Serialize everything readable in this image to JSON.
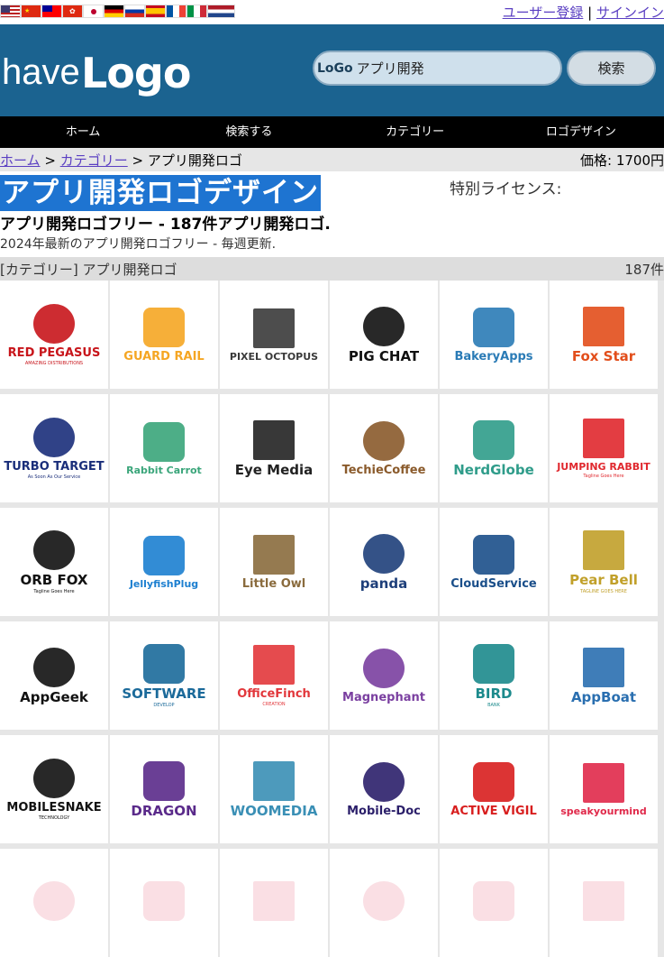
{
  "topbar": {
    "flags": [
      "us-flag",
      "cn-flag",
      "tw-flag",
      "hk-flag",
      "jp-flag",
      "de-flag",
      "ru-flag",
      "es-flag",
      "fr-flag",
      "it-flag",
      "nl-flag"
    ],
    "register": "ユーザー登録",
    "separator": "|",
    "signin": "サインイン"
  },
  "header": {
    "logo_have": "have",
    "logo_logo": "Logo",
    "search_logo": "LoGo",
    "search_value": "アプリ開発",
    "search_button": "検索"
  },
  "nav": [
    "ホーム",
    "検索する",
    "カテゴリー",
    "ロゴデザイン"
  ],
  "breadcrumb": {
    "home": "ホーム",
    "sep1": ">",
    "category": "カテゴリー",
    "sep2": ">",
    "current": "アプリ開発ロゴ",
    "price": "価格: 1700円"
  },
  "title": "アプリ開発ロゴデザイン",
  "license": "特別ライセンス:",
  "subtitle": "アプリ開発ロゴフリー - 187件アプリ開発ロゴ.",
  "description": "2024年最新のアプリ開発ロゴフリー - 毎週更新.",
  "category_bar": {
    "label": "[カテゴリー] アプリ開発ロゴ",
    "count": "187件"
  },
  "colors": {
    "header_bg": "#1b6390",
    "nav_bg": "#000000",
    "title_bg": "#1e74d1",
    "link": "#5a3fc2"
  },
  "logos": [
    {
      "name": "RED PEGASUS",
      "tag": "AMAZING DISTRIBUTIONS",
      "color": "#c8151b",
      "icon": "pegasus-icon"
    },
    {
      "name": "GUARD RAIL",
      "tag": "",
      "color": "#f5a623",
      "icon": "rail-icon"
    },
    {
      "name": "PIXEL OCTOPUS",
      "tag": "",
      "color": "#3a3a3a",
      "icon": "octopus-icon"
    },
    {
      "name": "PIG CHAT",
      "tag": "",
      "color": "#111111",
      "icon": "chat-bubble-icon"
    },
    {
      "name": "BakeryApps",
      "tag": "",
      "color": "#2a7bb6",
      "icon": "rolling-pin-icon"
    },
    {
      "name": "Fox Star",
      "tag": "",
      "color": "#e24e1b",
      "icon": "fox-icon"
    },
    {
      "name": "TURBO TARGET",
      "tag": "As Soon As Our Service",
      "color": "#1a2e7a",
      "icon": "target-icon"
    },
    {
      "name": "Rabbit Carrot",
      "tag": "",
      "color": "#3aa57a",
      "icon": "carrot-icon"
    },
    {
      "name": "Eye Media",
      "tag": "",
      "color": "#222222",
      "icon": "eye-icon"
    },
    {
      "name": "TechieCoffee",
      "tag": "",
      "color": "#8a5a2b",
      "icon": "coffee-bean-icon"
    },
    {
      "name": "NerdGlobe",
      "tag": "",
      "color": "#2f9c8a",
      "icon": "glasses-icon"
    },
    {
      "name": "JUMPING RABBIT",
      "tag": "Tagline Goes Here",
      "color": "#e0282e",
      "icon": "rabbit-icon"
    },
    {
      "name": "ORB FOX",
      "tag": "Tagline Goes Here",
      "color": "#111111",
      "icon": "fox-orb-icon"
    },
    {
      "name": "JellyfishPlug",
      "tag": "",
      "color": "#1c7fd0",
      "icon": "jellyfish-icon"
    },
    {
      "name": "Little Owl",
      "tag": "",
      "color": "#8a6b3d",
      "icon": "owl-icon"
    },
    {
      "name": "panda",
      "tag": "",
      "color": "#1e3f7a",
      "icon": "panda-icon"
    },
    {
      "name": "CloudService",
      "tag": "",
      "color": "#1b4f8a",
      "icon": "cloud-knot-icon"
    },
    {
      "name": "Pear Bell",
      "tag": "TAGLINE GOES HERE",
      "color": "#c1a02a",
      "icon": "pear-icon"
    },
    {
      "name": "AppGeek",
      "tag": "",
      "color": "#111111",
      "icon": "geek-icon"
    },
    {
      "name": "SOFTWARE",
      "tag": "DEVELOP",
      "color": "#1b6a9a",
      "icon": "pinwheel-icon"
    },
    {
      "name": "OfficeFinch",
      "tag": "CREATION",
      "color": "#e2373b",
      "icon": "finch-icon"
    },
    {
      "name": "Magnephant",
      "tag": "",
      "color": "#7a3fa0",
      "icon": "magnet-icon"
    },
    {
      "name": "BIRD",
      "tag": "BANK",
      "color": "#1c8a8c",
      "icon": "bird-icon"
    },
    {
      "name": "AppBoat",
      "tag": "",
      "color": "#2a6fb0",
      "icon": "boat-icon"
    },
    {
      "name": "MOBILESNAKE",
      "tag": "TECHNOLOGY",
      "color": "#111111",
      "icon": "snake-icon"
    },
    {
      "name": "DRAGON",
      "tag": "",
      "color": "#5a2a8a",
      "icon": "dragon-icon"
    },
    {
      "name": "WOOMEDIA",
      "tag": "",
      "color": "#3a8fb5",
      "icon": "wolf-icon"
    },
    {
      "name": "Mobile-Doc",
      "tag": "",
      "color": "#2b1f6a",
      "icon": "stethoscope-icon"
    },
    {
      "name": "ACTIVE VIGIL",
      "tag": "",
      "color": "#d81e1e",
      "icon": "heart-eye-icon"
    },
    {
      "name": "speakyourmind",
      "tag": "",
      "color": "#e0294a",
      "icon": "brain-icon"
    },
    {
      "name": "",
      "tag": "",
      "color": "#e0294a",
      "icon": "placeholder-icon"
    },
    {
      "name": "",
      "tag": "",
      "color": "#e0294a",
      "icon": "placeholder-icon"
    },
    {
      "name": "",
      "tag": "",
      "color": "#e0294a",
      "icon": "placeholder-icon"
    },
    {
      "name": "",
      "tag": "",
      "color": "#e0294a",
      "icon": "placeholder-icon"
    },
    {
      "name": "",
      "tag": "",
      "color": "#e0294a",
      "icon": "placeholder-icon"
    },
    {
      "name": "",
      "tag": "",
      "color": "#e0294a",
      "icon": "placeholder-icon"
    }
  ]
}
